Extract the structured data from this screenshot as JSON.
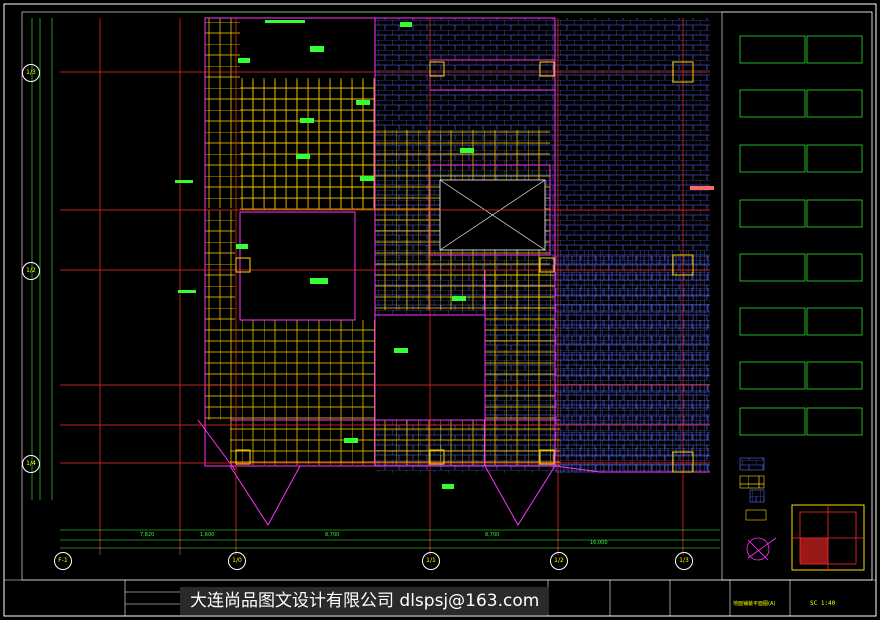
{
  "axes": {
    "left_labels": [
      "1/3",
      "1/2",
      "1/4"
    ],
    "bottom_labels": [
      "F-1",
      "1/0",
      "1/1",
      "1/2",
      "1/3"
    ]
  },
  "dimensions": {
    "bottom_row": [
      "7,820",
      "1,600",
      "8,700",
      "8,700",
      "16,000"
    ]
  },
  "title_block": {
    "drawing_title": "地面铺装平面图(A)",
    "scale": "SC 1:40"
  },
  "watermark": {
    "text": "大连尚品图文设计有限公司 dlspsj@163.com"
  },
  "colors": {
    "background": "#000000",
    "grid_red": "#ff2a2a",
    "wall_magenta": "#ff33ff",
    "tile_yellow": "#ffd800",
    "tile_blue": "#5b6cff",
    "annotation_green": "#33ff33",
    "frame_white": "#ffffff"
  }
}
